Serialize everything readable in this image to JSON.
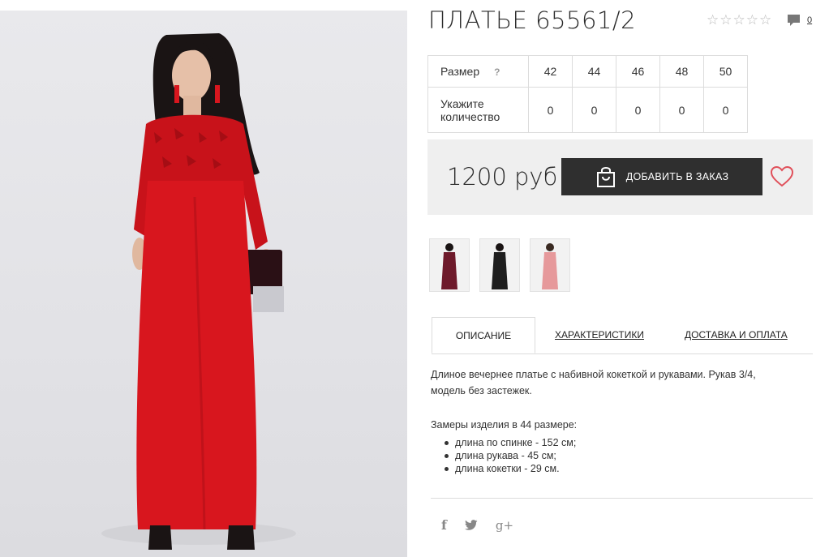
{
  "product": {
    "title": "ПЛАТЬЕ 65561/2",
    "rating": {
      "filled": 0,
      "max": 5
    },
    "comments_count": "0"
  },
  "sizes": {
    "header_label": "Размер",
    "help_label": "?",
    "qty_label_line1": "Укажите",
    "qty_label_line2": "количество",
    "values": [
      "42",
      "44",
      "46",
      "48",
      "50"
    ],
    "quantities": [
      "0",
      "0",
      "0",
      "0",
      "0"
    ]
  },
  "purchase": {
    "price": "1200 руб",
    "add_button_label": "ДОБАВИТЬ В ЗАКАЗ"
  },
  "thumbnails": [
    {
      "color_name": "burgundy",
      "color": "#6e1a2b"
    },
    {
      "color_name": "black",
      "color": "#1e1e1e"
    },
    {
      "color_name": "pink",
      "color": "#e6999b"
    }
  ],
  "tabs": [
    "ОПИСАНИЕ",
    "ХАРАКТЕРИСТИКИ",
    "ДОСТАВКА И ОПЛАТА"
  ],
  "description": {
    "line1": "Длиное вечернее платье с набивной кокеткой и рукавами. Рукав 3/4,",
    "line2": "модель без застежек.",
    "measures_title": "Замеры изделия в 44 размере:",
    "measures": [
      "длина по спинке - 152 см;",
      "длина рукава - 45 см;",
      "длина кокетки - 29 см."
    ]
  },
  "social": {
    "facebook": "f",
    "twitter": "🐦",
    "google": "g+"
  },
  "colors": {
    "accent_dark": "#2f2f2f",
    "heart": "#e0505a",
    "dress_red": "#d8161e"
  }
}
